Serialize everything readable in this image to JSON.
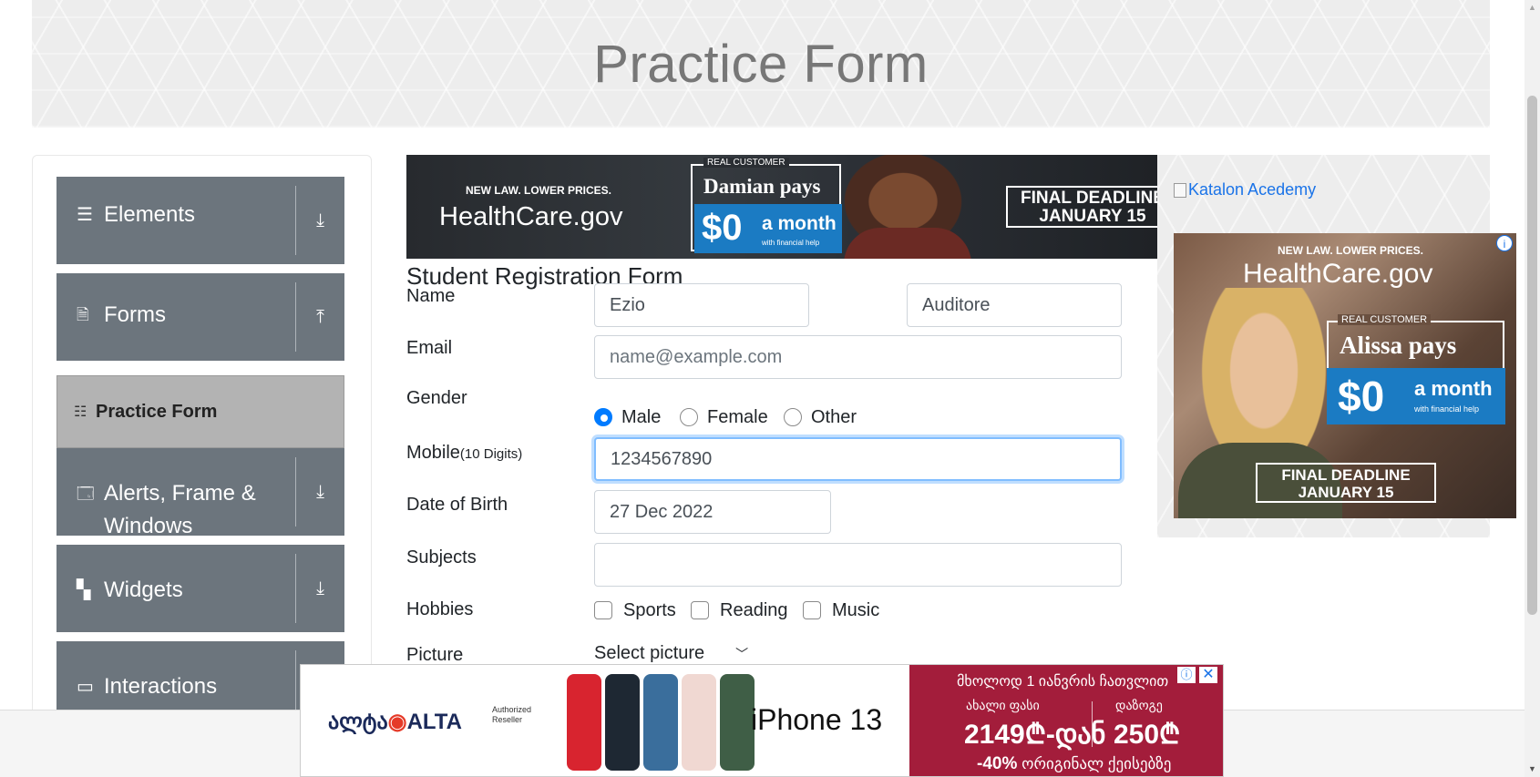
{
  "header": {
    "title": "Practice Form"
  },
  "sidebar": {
    "groups": [
      {
        "label": "Elements",
        "icon": "hamburger-icon",
        "toggle": "download-arrow-icon"
      },
      {
        "label": "Forms",
        "icon": "document-icon",
        "toggle": "upload-arrow-icon"
      },
      {
        "label": "Alerts, Frame &",
        "label2": "Windows",
        "icon": "window-icon",
        "toggle": "download-arrow-icon"
      },
      {
        "label": "Widgets",
        "icon": "widgets-icon",
        "toggle": "download-arrow-icon"
      },
      {
        "label": "Interactions",
        "icon": "interactions-icon",
        "toggle": "download-arrow-icon"
      }
    ],
    "active_item": "Practice Form"
  },
  "ad_top": {
    "newlaw": "NEW LAW. LOWER PRICES.",
    "brand": "HealthCare.gov",
    "real_customer": "REAL CUSTOMER",
    "person": "Damian pays",
    "amount": "$0",
    "per": "a month",
    "fine": "with financial help",
    "deadline1": "FINAL DEADLINE",
    "deadline2": "JANUARY 15"
  },
  "form": {
    "title": "Student Registration Form",
    "name_label": "Name",
    "first_name": "Ezio",
    "last_name": "Auditore",
    "email_label": "Email",
    "email_placeholder": "name@example.com",
    "gender_label": "Gender",
    "genders": [
      "Male",
      "Female",
      "Other"
    ],
    "gender_selected": "Male",
    "mobile_label": "Mobile",
    "mobile_hint": "(10 Digits)",
    "mobile_value": "1234567890",
    "dob_label": "Date of Birth",
    "dob_value": "27 Dec 2022",
    "subjects_label": "Subjects",
    "subjects_value": "",
    "hobbies_label": "Hobbies",
    "hobbies": [
      "Sports",
      "Reading",
      "Music"
    ],
    "picture_label": "Picture",
    "picture_button": "Select picture"
  },
  "right": {
    "katalon_alt": "Katalon Acedemy"
  },
  "ad_side": {
    "newlaw": "NEW LAW. LOWER PRICES.",
    "brand": "HealthCare.gov",
    "real_customer": "REAL CUSTOMER",
    "person": "Alissa pays",
    "amount": "$0",
    "per": "a month",
    "fine": "with financial help",
    "deadline1": "FINAL DEADLINE",
    "deadline2": "JANUARY 15"
  },
  "ad_bottom": {
    "alta_a": "ალტა",
    "alta_b": "ALTA",
    "authorized": "Authorized Reseller",
    "product": "iPhone 13",
    "line1": "მხოლოდ 1 იანვრის ჩათვლით",
    "new_price_label": "ახალი ფასი",
    "discount_label": "დაზოგე",
    "price": "2149₾-დან",
    "save": "250₾",
    "promo_pct": "-40%",
    "promo_text": "ორიგინალ ქეისებზე"
  },
  "colors": {
    "sidebar_bg": "#6c757d",
    "active_bg": "#b3b3b3",
    "radio_checked": "#007bff",
    "link": "#1a73e8",
    "ad_red": "#a31d3b",
    "ad_blue": "#1b7bc3"
  }
}
